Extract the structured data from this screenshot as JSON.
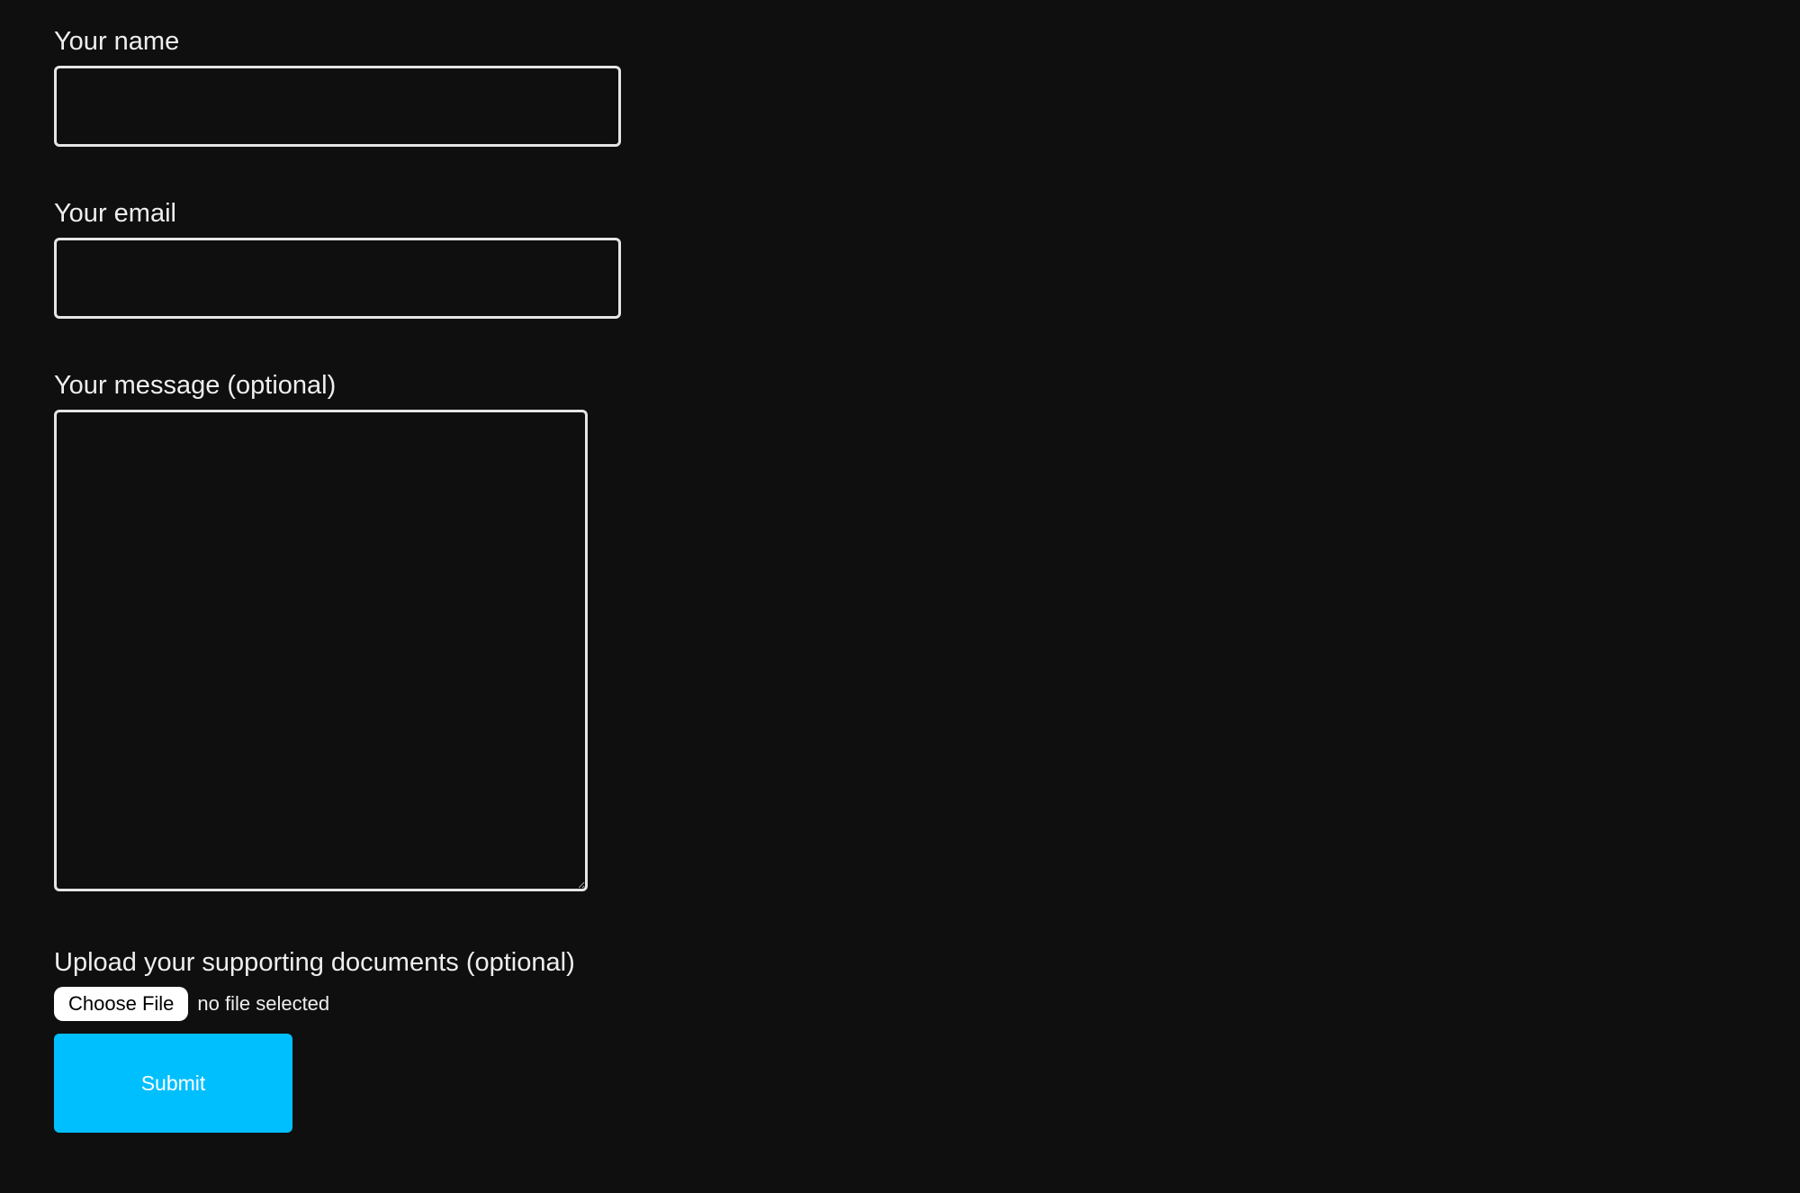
{
  "form": {
    "name": {
      "label": "Your name",
      "value": ""
    },
    "email": {
      "label": "Your email",
      "value": ""
    },
    "message": {
      "label": "Your message (optional)",
      "value": ""
    },
    "upload": {
      "label": "Upload your supporting documents (optional)",
      "button_label": "Choose File",
      "status": "no file selected"
    },
    "submit_label": "Submit"
  }
}
